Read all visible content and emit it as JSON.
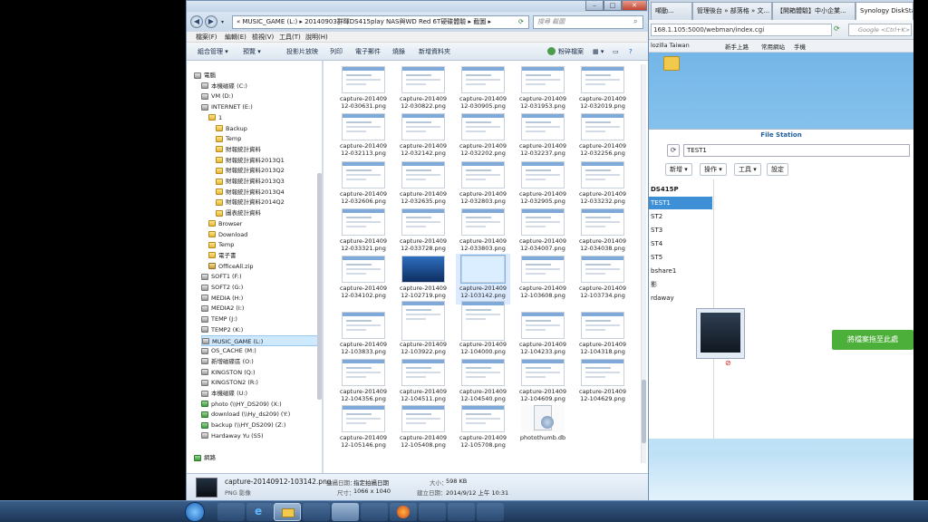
{
  "explorer": {
    "breadcrumb": "«  MUSIC_GAME (L:)  ▸  20140903群暉DS415play NAS與WD Red 6T硬碟體驗  ▸  截圖  ▸",
    "search_placeholder": "搜尋 截圖",
    "menu": [
      "檔案(F)",
      "編輯(E)",
      "檢視(V)",
      "工具(T)",
      "說明(H)"
    ],
    "commands": [
      "組合管理 ▾",
      "預覽 ▾",
      "投影片放映",
      "列印",
      "電子郵件",
      "燒錄",
      "新增資料夾"
    ],
    "commands_right": "粉碎檔案"
  },
  "nav": {
    "items": [
      {
        "label": "電腦",
        "icon": "computer-icon",
        "indent": 0
      },
      {
        "label": "本機磁碟 (C:)",
        "icon": "drive-icon",
        "indent": 1
      },
      {
        "label": "VM (D:)",
        "icon": "drive-icon",
        "indent": 1
      },
      {
        "label": "INTERNET (E:)",
        "icon": "drive-icon",
        "indent": 1
      },
      {
        "label": "1",
        "icon": "folder-icon",
        "indent": 2
      },
      {
        "label": "Backup",
        "icon": "folder-icon",
        "indent": 3
      },
      {
        "label": "Temp",
        "icon": "folder-icon",
        "indent": 3
      },
      {
        "label": "財報統計資料",
        "icon": "folder-icon",
        "indent": 3
      },
      {
        "label": "財報統計資料2013Q1",
        "icon": "folder-icon",
        "indent": 3
      },
      {
        "label": "財報統計資料2013Q2",
        "icon": "folder-icon",
        "indent": 3
      },
      {
        "label": "財報統計資料2013Q3",
        "icon": "folder-icon",
        "indent": 3
      },
      {
        "label": "財報統計資料2013Q4",
        "icon": "folder-icon",
        "indent": 3
      },
      {
        "label": "財報統計資料2014Q2",
        "icon": "folder-icon",
        "indent": 3
      },
      {
        "label": "圖表統計資料",
        "icon": "folder-icon",
        "indent": 3
      },
      {
        "label": "Browser",
        "icon": "folder-icon",
        "indent": 2
      },
      {
        "label": "Download",
        "icon": "folder-icon",
        "indent": 2
      },
      {
        "label": "Temp",
        "icon": "folder-icon",
        "indent": 2
      },
      {
        "label": "電子書",
        "icon": "folder-icon",
        "indent": 2
      },
      {
        "label": "OfficeAll.zip",
        "icon": "zip-icon",
        "indent": 2
      },
      {
        "label": "SOFT1 (F:)",
        "icon": "drive-icon",
        "indent": 1
      },
      {
        "label": "SOFT2 (G:)",
        "icon": "drive-icon",
        "indent": 1
      },
      {
        "label": "MEDIA (H:)",
        "icon": "drive-icon",
        "indent": 1
      },
      {
        "label": "MEDIA2 (I:)",
        "icon": "drive-icon",
        "indent": 1
      },
      {
        "label": "TEMP (J:)",
        "icon": "drive-icon",
        "indent": 1
      },
      {
        "label": "TEMP2 (K:)",
        "icon": "drive-icon",
        "indent": 1
      },
      {
        "label": "MUSIC_GAME (L:)",
        "icon": "drive-icon",
        "indent": 1,
        "selected": true
      },
      {
        "label": "OS_CACHE (M:)",
        "icon": "drive-icon",
        "indent": 1
      },
      {
        "label": "新增磁碟區 (O:)",
        "icon": "drive-icon",
        "indent": 1
      },
      {
        "label": "KINGSTON (Q:)",
        "icon": "drive-icon",
        "indent": 1
      },
      {
        "label": "KINGSTON2 (R:)",
        "icon": "drive-icon",
        "indent": 1
      },
      {
        "label": "本機磁碟 (U:)",
        "icon": "drive-icon",
        "indent": 1
      },
      {
        "label": "photo (\\\\HY_DS209) (X:)",
        "icon": "network-drive-icon",
        "indent": 1
      },
      {
        "label": "download (\\\\Hy_ds209) (Y:)",
        "icon": "network-drive-icon",
        "indent": 1
      },
      {
        "label": "backup (\\\\HY_DS209) (Z:)",
        "icon": "network-drive-icon",
        "indent": 1
      },
      {
        "label": "Hardaway Yu (S5)",
        "icon": "phone-icon",
        "indent": 1
      },
      {
        "label": "網路",
        "icon": "network-icon",
        "indent": 0
      }
    ]
  },
  "files": [
    {
      "l1": "capture-201409",
      "l2": "12-030631.png"
    },
    {
      "l1": "capture-201409",
      "l2": "12-030822.png"
    },
    {
      "l1": "capture-201409",
      "l2": "12-030905.png"
    },
    {
      "l1": "capture-201409",
      "l2": "12-031953.png"
    },
    {
      "l1": "capture-201409",
      "l2": "12-032019.png"
    },
    {
      "l1": "capture-201409",
      "l2": "12-032113.png"
    },
    {
      "l1": "capture-201409",
      "l2": "12-032142.png"
    },
    {
      "l1": "capture-201409",
      "l2": "12-032202.png"
    },
    {
      "l1": "capture-201409",
      "l2": "12-032237.png"
    },
    {
      "l1": "capture-201409",
      "l2": "12-032256.png"
    },
    {
      "l1": "capture-201409",
      "l2": "12-032606.png"
    },
    {
      "l1": "capture-201409",
      "l2": "12-032635.png"
    },
    {
      "l1": "capture-201409",
      "l2": "12-032803.png"
    },
    {
      "l1": "capture-201409",
      "l2": "12-032905.png"
    },
    {
      "l1": "capture-201409",
      "l2": "12-033232.png"
    },
    {
      "l1": "capture-201409",
      "l2": "12-033321.png"
    },
    {
      "l1": "capture-201409",
      "l2": "12-033728.png"
    },
    {
      "l1": "capture-201409",
      "l2": "12-033803.png"
    },
    {
      "l1": "capture-201409",
      "l2": "12-034007.png"
    },
    {
      "l1": "capture-201409",
      "l2": "12-034038.png"
    },
    {
      "l1": "capture-201409",
      "l2": "12-034102.png"
    },
    {
      "l1": "capture-201409",
      "l2": "12-102719.png",
      "thumb": "dark"
    },
    {
      "l1": "capture-201409",
      "l2": "12-103142.png",
      "thumb": "dark2",
      "selected": true
    },
    {
      "l1": "capture-201409",
      "l2": "12-103608.png"
    },
    {
      "l1": "capture-201409",
      "l2": "12-103734.png"
    },
    {
      "l1": "capture-201409",
      "l2": "12-103833.png"
    },
    {
      "l1": "capture-201409",
      "l2": "12-103922.png"
    },
    {
      "l1": "capture-201409",
      "l2": "12-104000.png"
    },
    {
      "l1": "capture-201409",
      "l2": "12-104233.png"
    },
    {
      "l1": "capture-201409",
      "l2": "12-104318.png"
    },
    {
      "l1": "capture-201409",
      "l2": "12-104356.png"
    },
    {
      "l1": "capture-201409",
      "l2": "12-104511.png"
    },
    {
      "l1": "capture-201409",
      "l2": "12-104540.png"
    },
    {
      "l1": "capture-201409",
      "l2": "12-104609.png"
    },
    {
      "l1": "capture-201409",
      "l2": "12-104629.png"
    },
    {
      "l1": "capture-201409",
      "l2": "12-105146.png"
    },
    {
      "l1": "capture-201409",
      "l2": "12-105408.png"
    },
    {
      "l1": "capture-201409",
      "l2": "12-105708.png"
    },
    {
      "l1": "photothumb.db",
      "l2": "",
      "thumb": "db"
    }
  ],
  "details": {
    "filename": "capture-20140912-103142.png",
    "filetype": "PNG 影像",
    "taken_label": "拍攝日期：",
    "taken_value": "指定拍攝日期",
    "size_label": "大小：",
    "size_value": "598 KB",
    "dim_label": "尺寸：",
    "dim_value": "1066 x 1040",
    "created_label": "建立日期：",
    "created_value": "2014/9/12 上午 10:31"
  },
  "browser": {
    "tabs": [
      "噸動...",
      "管理後台 » 部落格 » 文...",
      "【開箱體驗】中小企業...",
      "Synology DiskStati..."
    ],
    "url": "168.1.105:5000/webman/index.cgi",
    "search_placeholder": "Google <Ctrl+K>",
    "bookmarks": [
      "lozilla Taiwan",
      "新手上路",
      "常用網站",
      "手機"
    ],
    "fs_title": "File Station",
    "fs_path": "TEST1",
    "fs_buttons": [
      "新增 ▾",
      "操作 ▾",
      "工具 ▾",
      "設定"
    ],
    "fs_dirs": [
      "DS415P",
      "TEST1",
      "ST2",
      "ST3",
      "ST4",
      "ST5",
      "bshare1",
      "影",
      "rdaway"
    ],
    "drop_label": "將檔案拖至此處"
  },
  "colors": {
    "accent": "#4caf3a",
    "selection": "#cde8ff",
    "title_blue": "#1f5f9f"
  }
}
